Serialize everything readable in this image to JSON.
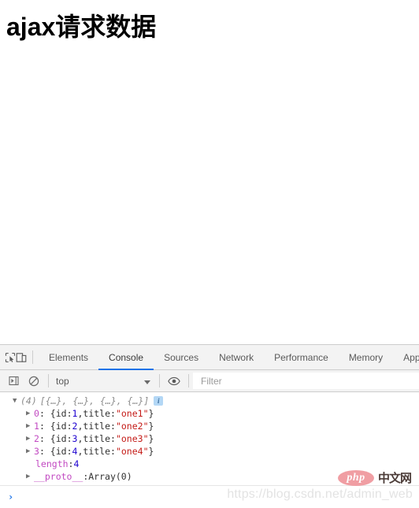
{
  "page": {
    "title": "ajax请求数据"
  },
  "devtools": {
    "left_icons": [
      {
        "name": "inspect-element-icon",
        "label": "inspect-element-icon"
      },
      {
        "name": "device-toolbar-icon",
        "label": "device-toolbar-icon"
      }
    ],
    "tabs": [
      {
        "label": "Elements",
        "active": false
      },
      {
        "label": "Console",
        "active": true
      },
      {
        "label": "Sources",
        "active": false
      },
      {
        "label": "Network",
        "active": false
      },
      {
        "label": "Performance",
        "active": false
      },
      {
        "label": "Memory",
        "active": false
      },
      {
        "label": "App",
        "active": false
      }
    ],
    "subbar": {
      "execute_icon": "execute-snippet-icon",
      "clear_icon": "clear-console-icon",
      "context_value": "top",
      "context_caret": "▼",
      "eye_icon": "eye-icon",
      "filter_placeholder": "Filter",
      "filter_value": ""
    },
    "console": {
      "array_row": {
        "triangle": "▼",
        "count": "(4)",
        "preview": "[{…}, {…}, {…}, {…}]",
        "info_badge": "i"
      },
      "items": [
        {
          "triangle": "▶",
          "index": "0",
          "sep": ": {",
          "key": "id",
          "keysep": ": ",
          "num": "1",
          "comma": ", ",
          "key2": "title",
          "keysep2": ": ",
          "str": "\"one1\"",
          "close": "}"
        },
        {
          "triangle": "▶",
          "index": "1",
          "sep": ": {",
          "key": "id",
          "keysep": ": ",
          "num": "2",
          "comma": ", ",
          "key2": "title",
          "keysep2": ": ",
          "str": "\"one2\"",
          "close": "}"
        },
        {
          "triangle": "▶",
          "index": "2",
          "sep": ": {",
          "key": "id",
          "keysep": ": ",
          "num": "3",
          "comma": ", ",
          "key2": "title",
          "keysep2": ": ",
          "str": "\"one3\"",
          "close": "}"
        },
        {
          "triangle": "▶",
          "index": "3",
          "sep": ": {",
          "key": "id",
          "keysep": ": ",
          "num": "4",
          "comma": ", ",
          "key2": "title",
          "keysep2": ": ",
          "str": "\"one4\"",
          "close": "}"
        }
      ],
      "length_row": {
        "prop": "length",
        "sep": ": ",
        "value": "4"
      },
      "proto_row": {
        "triangle": "▶",
        "prop": "__proto__",
        "sep": ": ",
        "value": "Array(0)"
      }
    },
    "prompt": {
      "caret": "›"
    }
  },
  "watermarks": {
    "php_logo_text": "php",
    "php_logo_cn": "中文网",
    "url": "https://blog.csdn.net/admin_web"
  },
  "colors": {
    "accent_blue": "#1a73e8",
    "devtools_bg": "#f3f3f3",
    "string_red": "#c41a16",
    "number_blue": "#1c00cf",
    "property_purple": "#c24ac2",
    "php_pink": "#f09ea3"
  }
}
